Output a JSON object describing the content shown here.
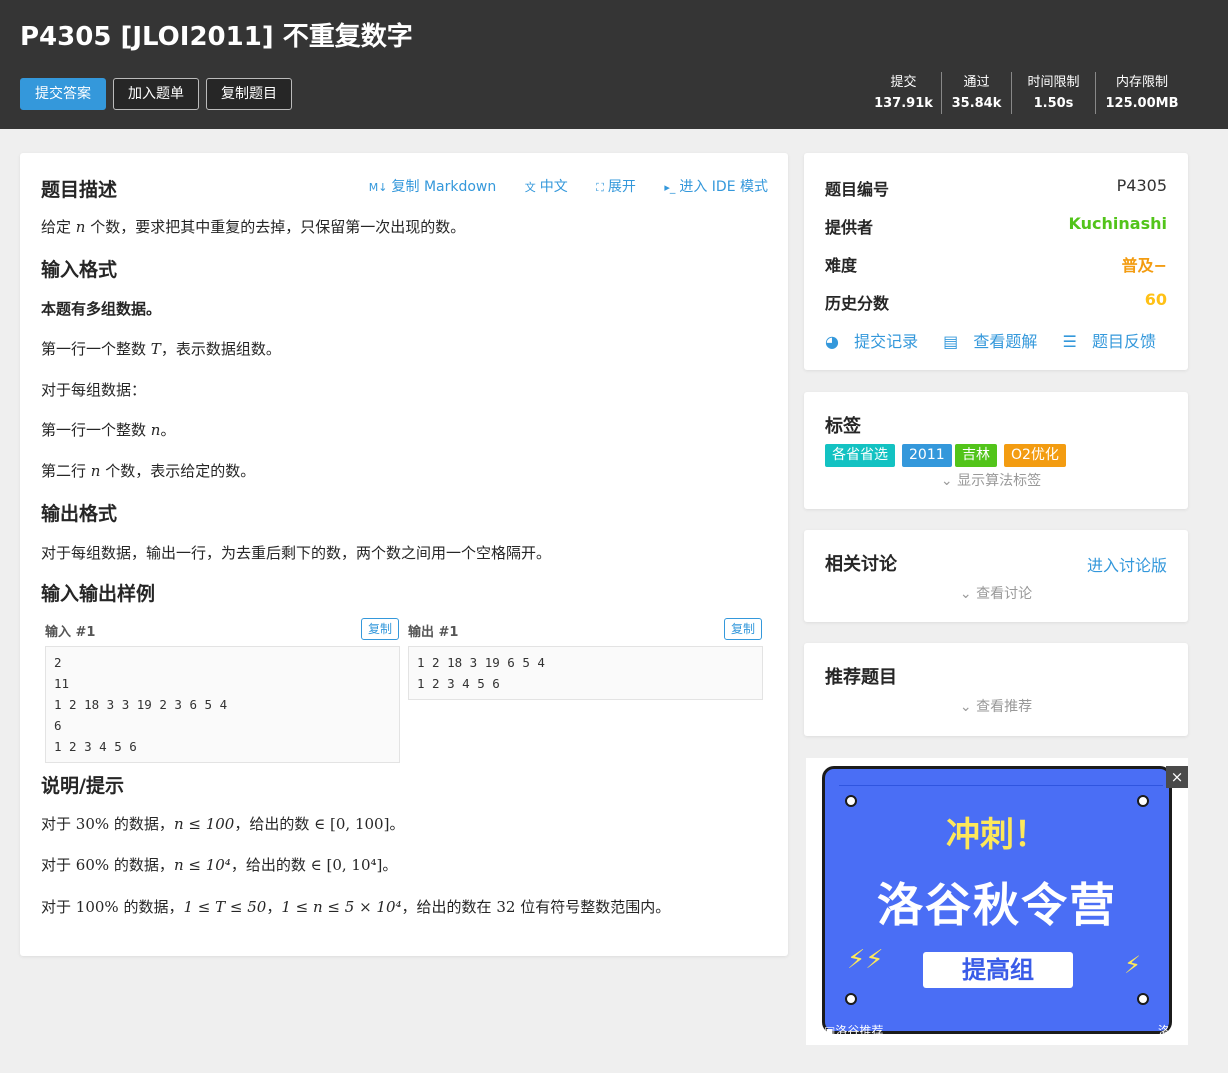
{
  "header": {
    "title": "P4305 [JLOI2011] 不重复数字",
    "buttons": {
      "submit": "提交答案",
      "add_list": "加入题单",
      "copy": "复制题目"
    },
    "stats": [
      {
        "label": "提交",
        "value": "137.91k"
      },
      {
        "label": "通过",
        "value": "35.84k"
      },
      {
        "label": "时间限制",
        "value": "1.50s"
      },
      {
        "label": "内存限制",
        "value": "125.00MB"
      }
    ]
  },
  "main": {
    "heading_desc": "题目描述",
    "tools": {
      "markdown": "复制 Markdown",
      "chinese": "中文",
      "expand": "展开",
      "ide": "进入 IDE 模式"
    },
    "desc": {
      "pre": "给定",
      "var": "n",
      "post": "个数，要求把其中重复的去掉，只保留第一次出现的数。"
    },
    "heading_input": "输入格式",
    "input_bold": "本题有多组数据。",
    "input_l1_pre": "第一行一个整数",
    "input_l1_var": "T",
    "input_l1_post": "，表示数据组数。",
    "input_l2": "对于每组数据：",
    "input_l3_pre": "第一行一个整数",
    "input_l3_var": "n",
    "input_l3_post": "。",
    "input_l4_pre": "第二行",
    "input_l4_var": "n",
    "input_l4_post": "个数，表示给定的数。",
    "heading_output": "输出格式",
    "output_text": "对于每组数据，输出一行，为去重后剩下的数，两个数之间用一个空格隔开。",
    "heading_samples": "输入输出样例",
    "sample_in_label": "输入 #1",
    "sample_out_label": "输出 #1",
    "copy_label": "复制",
    "sample_in": "2\n11\n1 2 18 3 3 19 2 3 6 5 4\n6\n1 2 3 4 5 6",
    "sample_out": "1 2 18 3 19 6 5 4\n1 2 3 4 5 6",
    "heading_hint": "说明/提示",
    "hint1": {
      "a": "对于",
      "pct": "30%",
      "b": "的数据，",
      "cond": "n ≤ 100",
      "c": "，给出的数",
      "range": "∈ [0, 100]",
      "d": "。"
    },
    "hint2": {
      "a": "对于",
      "pct": "60%",
      "b": "的数据，",
      "cond": "n ≤ 10⁴",
      "c": "，给出的数",
      "range": "∈ [0, 10⁴]",
      "d": "。"
    },
    "hint3": {
      "a": "对于",
      "pct": "100%",
      "b": "的数据，",
      "cond1": "1 ≤ T ≤ 50",
      "sep": "，",
      "cond2": "1 ≤ n ≤ 5 × 10⁴",
      "c": "，给出的数在",
      "bits": "32",
      "d": "位有符号整数范围内。"
    }
  },
  "info": {
    "id_label": "题目编号",
    "id_value": "P4305",
    "provider_label": "提供者",
    "provider_value": "Kuchinashi",
    "difficulty_label": "难度",
    "difficulty_value": "普及−",
    "score_label": "历史分数",
    "score_value": "60",
    "links": {
      "records": "提交记录",
      "solutions": "查看题解",
      "feedback": "题目反馈"
    },
    "colors": {
      "provider": "#52c41a",
      "difficulty": "#f39c11",
      "score": "#ffc116",
      "link": "#3498db"
    }
  },
  "tags": {
    "title": "标签",
    "items": [
      {
        "label": "各省省选",
        "color": "#13c2c2"
      },
      {
        "label": "2011",
        "color": "#3498db"
      },
      {
        "label": "吉林",
        "color": "#52c41a"
      },
      {
        "label": "O2优化",
        "color": "#f39c11"
      }
    ],
    "show_algo": "显示算法标签"
  },
  "discuss": {
    "title": "相关讨论",
    "link": "进入讨论版",
    "more": "查看讨论"
  },
  "recommend": {
    "title": "推荐题目",
    "more": "查看推荐"
  },
  "ad": {
    "title1": "冲刺！",
    "title2": "洛谷秋令营",
    "band": "提高组",
    "footer": "洛谷推荐",
    "footer2": "洛谷",
    "close": "×"
  }
}
